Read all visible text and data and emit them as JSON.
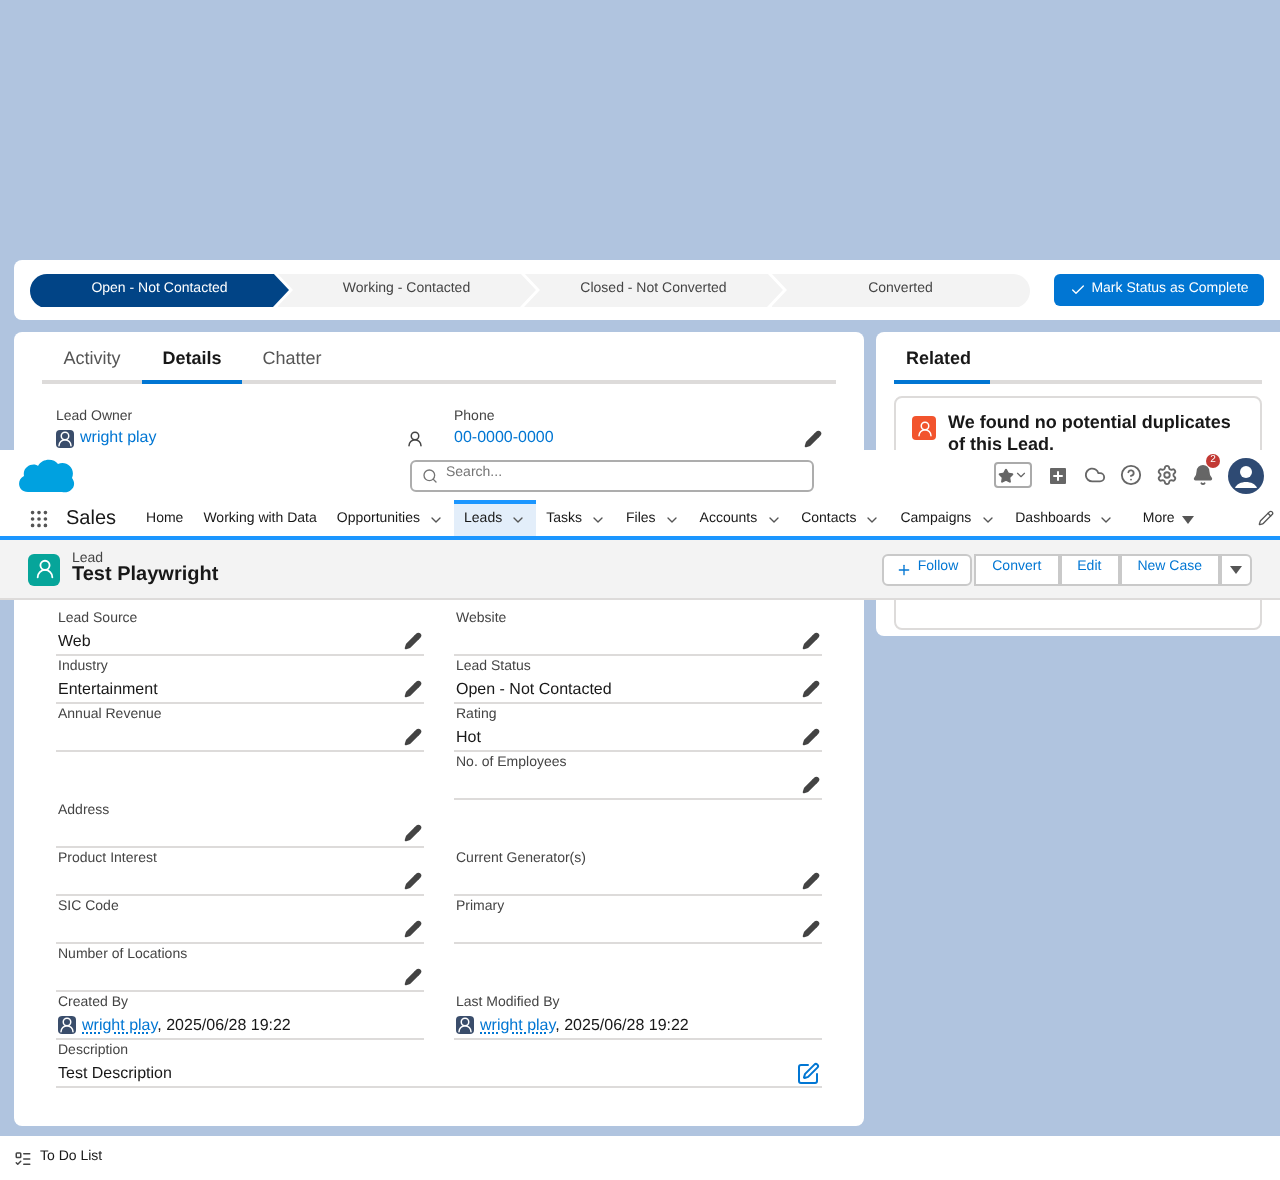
{
  "path": {
    "steps": [
      {
        "label": "Open - Not Contacted",
        "selected": true
      },
      {
        "label": "Working - Contacted",
        "selected": false
      },
      {
        "label": "Closed - Not Converted",
        "selected": false
      },
      {
        "label": "Converted",
        "selected": false
      }
    ],
    "action": "Mark Status as Complete"
  },
  "detail_tabs": [
    {
      "label": "Activity",
      "selected": false
    },
    {
      "label": "Details",
      "selected": true
    },
    {
      "label": "Chatter",
      "selected": false
    }
  ],
  "lead_owner": {
    "label": "Lead Owner",
    "value": "wright play"
  },
  "phone": {
    "label": "Phone",
    "value": "00-0000-0000"
  },
  "fields": [
    {
      "kind": "text",
      "label": "Lead Source",
      "value": "Web",
      "editable": true
    },
    {
      "kind": "text",
      "label": "Website",
      "editable": true
    },
    {
      "kind": "text",
      "label": "Industry",
      "value": "Entertainment",
      "editable": true
    },
    {
      "kind": "text",
      "label": "Lead Status",
      "value": "Open - Not Contacted",
      "editable": true
    },
    {
      "kind": "text",
      "label": "Annual Revenue",
      "editable": true
    },
    {
      "kind": "text",
      "label": "Rating",
      "value": "Hot",
      "editable": true
    },
    {
      "kind": "empty"
    },
    {
      "kind": "text",
      "label": "No. of Employees",
      "editable": true
    },
    {
      "kind": "text",
      "label": "Address",
      "editable": true
    },
    {
      "kind": "empty"
    },
    {
      "kind": "text",
      "label": "Product Interest",
      "editable": true
    },
    {
      "kind": "text",
      "label": "Current Generator(s)",
      "editable": true
    },
    {
      "kind": "text",
      "label": "SIC Code",
      "editable": true
    },
    {
      "kind": "text",
      "label": "Primary",
      "editable": true
    },
    {
      "kind": "text",
      "label": "Number of Locations",
      "editable": true
    },
    {
      "kind": "empty"
    },
    {
      "kind": "user",
      "label": "Created By",
      "user": "wright play",
      "suffix": ", 2025/06/28 19:22",
      "editable": false
    },
    {
      "kind": "user",
      "label": "Last Modified By",
      "user": "wright play",
      "suffix": ", 2025/06/28 19:22",
      "editable": false
    },
    {
      "kind": "wide",
      "label": "Description",
      "value": "Test Description",
      "editable": true
    }
  ],
  "related": {
    "tab": "Related",
    "message": "We found no potential duplicates of this Lead."
  },
  "header": {
    "search_placeholder": "Search...",
    "notifications": "2"
  },
  "nav": {
    "app": "Sales",
    "items": [
      {
        "kind": "tab",
        "label": "Home",
        "dropdown": false,
        "selected": false
      },
      {
        "kind": "tab",
        "label": "Working with Data",
        "dropdown": false,
        "selected": false
      },
      {
        "kind": "tab",
        "label": "Opportunities",
        "dropdown": true,
        "selected": false
      },
      {
        "kind": "tab",
        "label": "Leads",
        "dropdown": true,
        "selected": true
      },
      {
        "kind": "tab",
        "label": "Tasks",
        "dropdown": true,
        "selected": false
      },
      {
        "kind": "tab",
        "label": "Files",
        "dropdown": true,
        "selected": false
      },
      {
        "kind": "tab",
        "label": "Accounts",
        "dropdown": true,
        "selected": false
      },
      {
        "kind": "tab",
        "label": "Contacts",
        "dropdown": true,
        "selected": false
      },
      {
        "kind": "tab",
        "label": "Campaigns",
        "dropdown": true,
        "selected": false
      },
      {
        "kind": "tab",
        "label": "Dashboards",
        "dropdown": true,
        "selected": false
      },
      {
        "kind": "more",
        "label": "More",
        "dropdown": true,
        "selected": false
      }
    ]
  },
  "record": {
    "type": "Lead",
    "name": "Test Playwright",
    "buttons": [
      {
        "kind": "follow",
        "label": "Follow"
      },
      {
        "kind": "group",
        "label": "Convert"
      },
      {
        "kind": "group",
        "label": "Edit"
      },
      {
        "kind": "group",
        "label": "New Case"
      }
    ]
  },
  "footer": {
    "todo": "To Do List"
  }
}
